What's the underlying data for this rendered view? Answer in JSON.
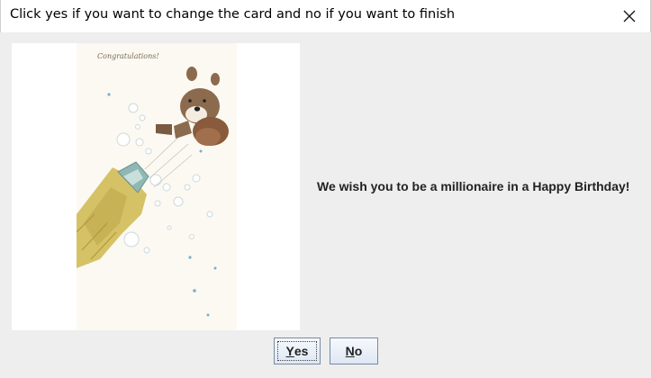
{
  "window": {
    "title": "Click yes if you want to change the card and no if you want to finish"
  },
  "card": {
    "image_text": "Congratulations!"
  },
  "dialog": {
    "message": "We wish you to be a millionaire in a Happy Birthday!"
  },
  "buttons": {
    "yes": {
      "mnemonic": "Y",
      "rest": "es"
    },
    "no": {
      "mnemonic": "N",
      "rest": "o"
    }
  },
  "colors": {
    "dialog_background": "#eeeeee",
    "titlebar_background": "#ffffff",
    "button_border": "#7a8aa3"
  },
  "icons": {
    "close": "close-icon"
  }
}
